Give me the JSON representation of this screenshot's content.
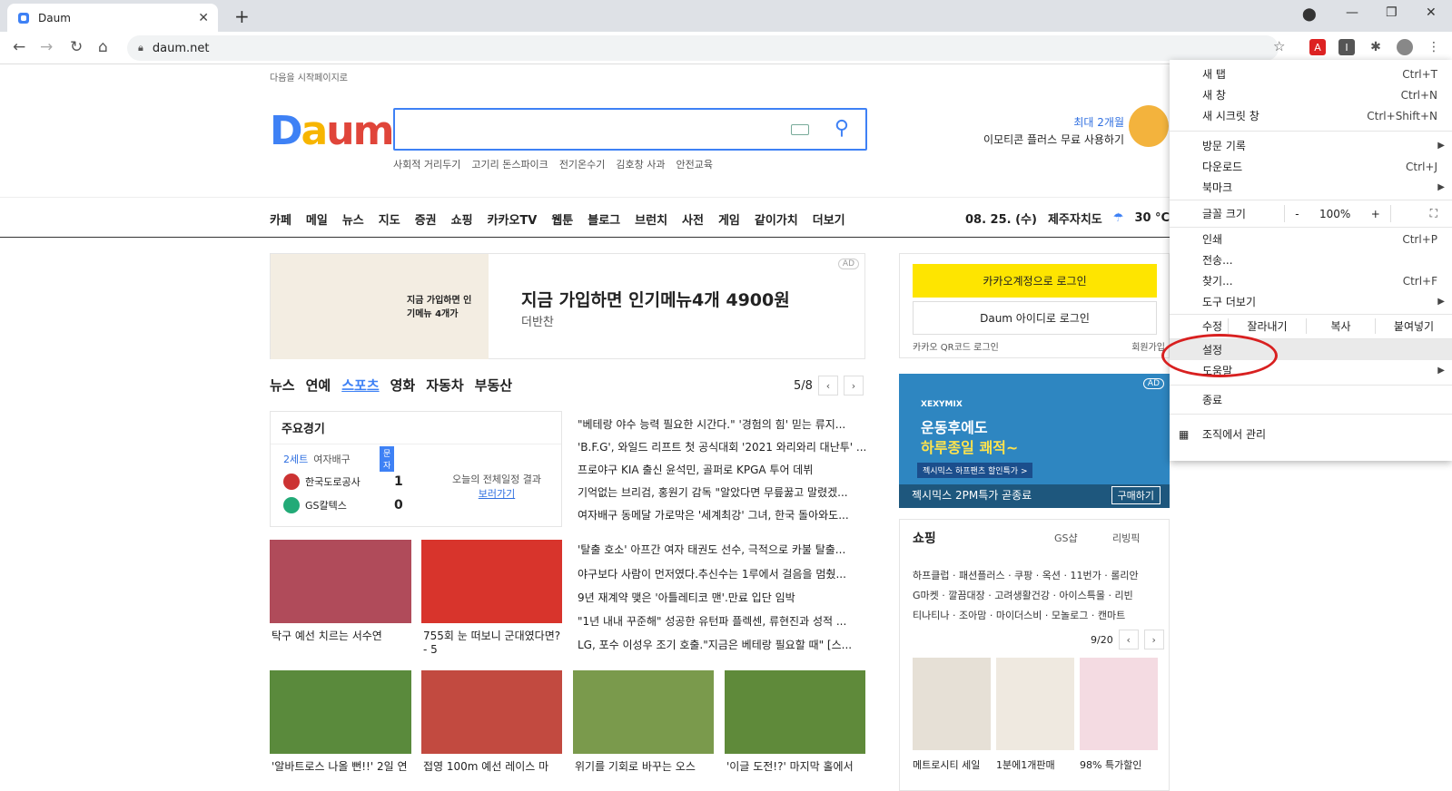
{
  "browser": {
    "tab_title": "Daum",
    "url": "daum.net"
  },
  "page": {
    "startpage_link": "다음을 시작페이지로",
    "logo": "Daum",
    "keywords": [
      "사회적 거리두기",
      "고기리 돈스파이크",
      "전기온수기",
      "김호창 사과",
      "안전교육"
    ],
    "promo_line1": "최대 2개월",
    "promo_line2": "이모티콘 플러스 무료 사용하기",
    "gnb": [
      "카페",
      "메일",
      "뉴스",
      "지도",
      "증권",
      "쇼핑",
      "카카오TV",
      "웹툰",
      "블로그",
      "브런치",
      "사전",
      "게임",
      "같이가치",
      "더보기"
    ],
    "date": "08. 25. (수)",
    "region": "제주자치도",
    "temp": "30 °C",
    "ad1": {
      "img_text": "지금 가입하면 인기메뉴 4개가",
      "title": "지금 가입하면 인기메뉴4개 4900원",
      "sub": "더반찬",
      "tag": "AD"
    },
    "news_tabs": [
      "뉴스",
      "연예",
      "스포츠",
      "영화",
      "자동차",
      "부동산"
    ],
    "news_page": "5/8",
    "score": {
      "title": "주요경기",
      "set": "2세트",
      "sport": "여자배구",
      "badge": "문자",
      "team1": "한국도로공사",
      "score1": "1",
      "team2": "GS칼텍스",
      "score2": "0",
      "result": "오늘의 전체일정 결과",
      "link": "보러가기"
    },
    "headlines1": [
      "\"베테랑 야수 능력 필요한 시간다.\" '경험의 힘' 믿는 류지...",
      "'B.F.G', 와일드 리프트 첫 공식대회 '2021 와리와리 대난투' ...",
      "프로야구 KIA 출신 윤석민, 골퍼로 KPGA 투어 데뷔",
      "기억없는 브리검, 홍원기 감독 \"알았다면 무릎꿇고 말렸겠...",
      "여자배구 동메달 가로막은 '세계최강' 그녀, 한국 돌아와도..."
    ],
    "headlines2": [
      "'탈출 호소' 아프간 여자 태권도 선수, 극적으로 카불 탈출...",
      "야구보다 사람이 먼저였다.추신수는 1루에서 걸음을 멈췄...",
      "9년 재계약 맺은 '아틀레티코 맨'.만료 입단 임박",
      "\"1년 내내 꾸준해\" 성공한 유턴파 플렉센, 류현진과 성적 ...",
      "LG, 포수 이성우 조기 호출.\"지금은 베테랑 필요할 때\" [스..."
    ],
    "cap1": "탁구 예선 치르는 서수연",
    "cap2": "755회 눈 떠보니 군대였다면? - 5",
    "caps_bottom": [
      "'알바트로스 나올 뻔!!' 2일 연",
      "접영 100m 예선 레이스 마",
      "위기를 기회로 바꾸는 오스",
      "'이글 도전!?' 마지막 홀에서"
    ],
    "login": {
      "kakao": "카카오계정으로 로그인",
      "daum": "Daum 아이디로 로그인",
      "qr": "카카오 QR코드 로그인",
      "reg": "회원가입"
    },
    "ad2": {
      "brand": "XEXYMIX",
      "l1": "운동후에도",
      "l2": "하루종일 쾌적~",
      "btn": "젝시믹스 하프팬츠 할인특가 >",
      "cap": "젝시믹스 2PM특가 곧종료",
      "buy": "구매하기",
      "tag": "AD"
    },
    "shop": {
      "title": "쇼핑",
      "p1": "GS샵",
      "p2": "리빙픽",
      "l1": "하프클럽 · 패션플러스 · 쿠팡 · 옥션 · 11번가 · 롤리안",
      "l2": "G마켓 · 깔끔대장 · 고려생활건강 · 아이스특몰 · 리빈",
      "l3": "티나티나 · 조아맘 · 마이더스비 · 모놀로그 · 캔마트",
      "page": "9/20",
      "c1": "메트로시티 세일",
      "c2": "1분에1개판매",
      "c3": "98% 특가할인"
    }
  },
  "menu": {
    "new_tab": "새 탭",
    "new_tab_sc": "Ctrl+T",
    "new_window": "새 창",
    "new_window_sc": "Ctrl+N",
    "incognito": "새 시크릿 창",
    "incognito_sc": "Ctrl+Shift+N",
    "history": "방문 기록",
    "downloads": "다운로드",
    "downloads_sc": "Ctrl+J",
    "bookmarks": "북마크",
    "zoom": "글꼴 크기",
    "zoom_minus": "-",
    "zoom_val": "100%",
    "zoom_plus": "+",
    "print": "인쇄",
    "print_sc": "Ctrl+P",
    "cast": "전송...",
    "find": "찾기...",
    "find_sc": "Ctrl+F",
    "more_tools": "도구 더보기",
    "edit": "수정",
    "cut": "잘라내기",
    "copy": "복사",
    "paste": "붙여넣기",
    "settings": "설정",
    "help": "도움말",
    "exit": "종료",
    "managed": "조직에서 관리"
  }
}
